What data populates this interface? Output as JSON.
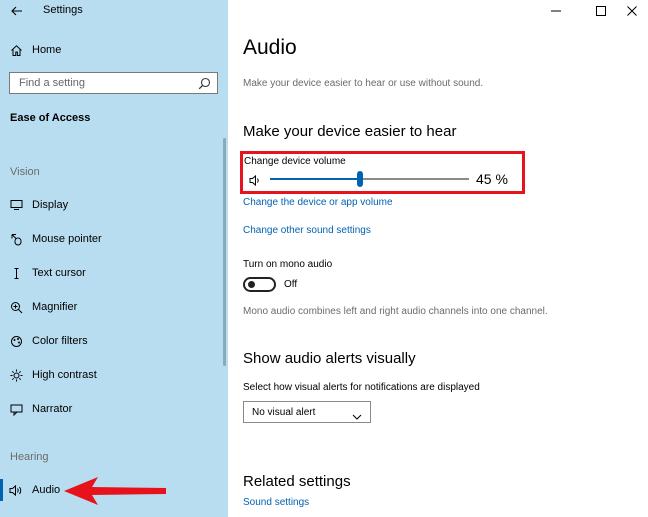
{
  "window": {
    "app_title": "Settings",
    "controls": [
      "minimize",
      "maximize",
      "close"
    ]
  },
  "sidebar": {
    "home_label": "Home",
    "search_placeholder": "Find a setting",
    "category": "Ease of Access",
    "groups": [
      {
        "label": "Vision",
        "items": [
          {
            "label": "Display",
            "icon": "display-icon"
          },
          {
            "label": "Mouse pointer",
            "icon": "mouse-pointer-icon"
          },
          {
            "label": "Text cursor",
            "icon": "text-cursor-icon"
          },
          {
            "label": "Magnifier",
            "icon": "magnifier-icon"
          },
          {
            "label": "Color filters",
            "icon": "color-filters-icon"
          },
          {
            "label": "High contrast",
            "icon": "high-contrast-icon"
          },
          {
            "label": "Narrator",
            "icon": "narrator-icon"
          }
        ]
      },
      {
        "label": "Hearing",
        "items": [
          {
            "label": "Audio",
            "icon": "audio-icon",
            "selected": true
          }
        ]
      }
    ]
  },
  "main": {
    "title": "Audio",
    "subtitle": "Make your device easier to hear or use without sound.",
    "section_hear": {
      "heading": "Make your device easier to hear",
      "volume_label": "Change device volume",
      "volume_value": 45,
      "volume_text": "45 %",
      "link_device_app_volume": "Change the device or app volume",
      "link_other_sound": "Change other sound settings",
      "mono_label": "Turn on mono audio",
      "mono_state": "Off",
      "mono_desc": "Mono audio combines left and right audio channels into one channel."
    },
    "section_alerts": {
      "heading": "Show audio alerts visually",
      "select_label": "Select how visual alerts for notifications are displayed",
      "select_value": "No visual alert"
    },
    "section_related": {
      "heading": "Related settings",
      "link_sound_settings": "Sound settings"
    }
  },
  "colors": {
    "sidebar_bg": "#b9ddf0",
    "accent": "#0063b1",
    "highlight_red": "#e8121d"
  }
}
